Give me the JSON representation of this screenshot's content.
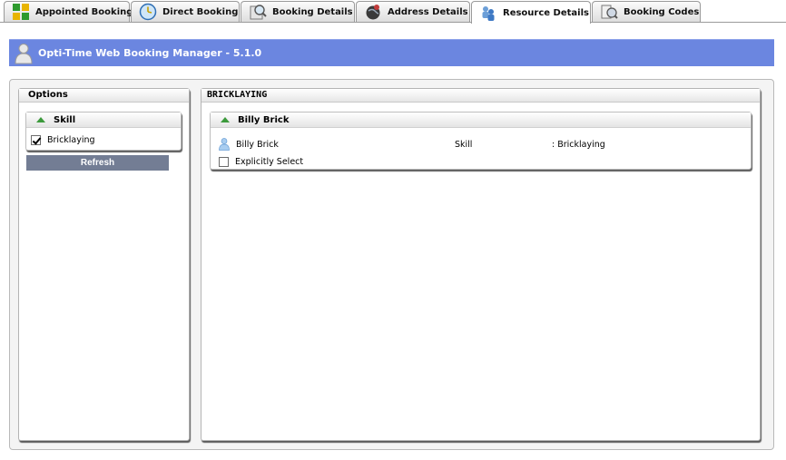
{
  "tabs": [
    {
      "label": "Appointed Booking",
      "icon": "appointed-booking-icon",
      "active": false
    },
    {
      "label": "Direct Booking",
      "icon": "clock-icon",
      "active": false
    },
    {
      "label": "Booking Details",
      "icon": "magnifier-icon",
      "active": false
    },
    {
      "label": "Address Details",
      "icon": "globe-icon",
      "active": false
    },
    {
      "label": "Resource Details",
      "icon": "resources-icon",
      "active": true
    },
    {
      "label": "Booking Codes",
      "icon": "codes-icon",
      "active": false
    }
  ],
  "header": {
    "title": "Opti-Time Web Booking Manager - 5.1.0",
    "icon": "user-icon"
  },
  "options": {
    "title": "Options",
    "group_title": "Skill",
    "items": [
      {
        "label": "Bricklaying",
        "checked": true
      }
    ],
    "refresh_label": "Refresh"
  },
  "details": {
    "title": "BRICKLAYING",
    "resource": {
      "name": "Billy Brick",
      "row_name": "Billy Brick",
      "attr_label": "Skill",
      "attr_value": ": Bricklaying",
      "explicit_label": "Explicitly Select",
      "explicit_checked": false
    }
  },
  "colors": {
    "header_bg": "#6b86e0",
    "refresh_bg": "#737d94",
    "accent_green": "#3c9a3c"
  }
}
